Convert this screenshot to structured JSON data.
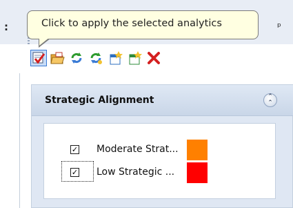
{
  "tooltip": {
    "text": "Click to apply the selected analytics"
  },
  "toolbar": {
    "buttons": [
      {
        "icon": "apply-analytics-icon"
      },
      {
        "icon": "open-folder-icon"
      },
      {
        "icon": "refresh-icon"
      },
      {
        "icon": "refresh-all-icon"
      },
      {
        "icon": "new-item-icon"
      },
      {
        "icon": "new-item-alt-icon"
      },
      {
        "icon": "delete-icon"
      }
    ]
  },
  "panel": {
    "title": "Strategic Alignment",
    "items": [
      {
        "label": "Moderate Strat...",
        "checked": true,
        "color": "#ff8000"
      },
      {
        "label": "Low Strategic ...",
        "checked": true,
        "color": "#ff0000"
      }
    ]
  },
  "colors": {
    "delete": "#d42020",
    "accent": "#3a7bd5"
  }
}
